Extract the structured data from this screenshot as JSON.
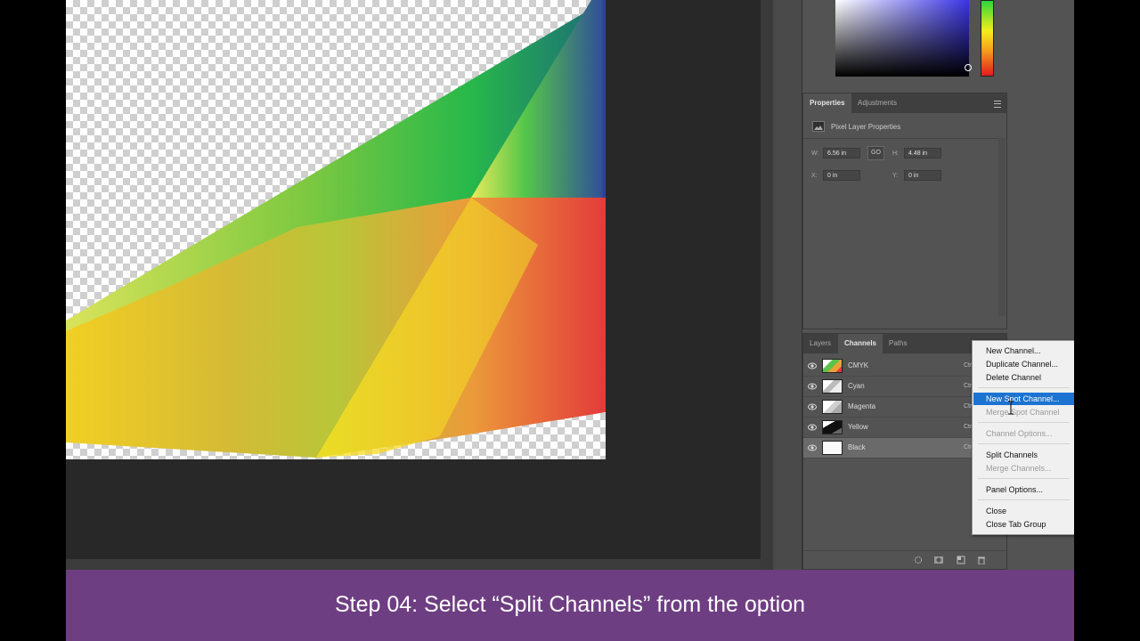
{
  "properties_panel": {
    "tabs": [
      "Properties",
      "Adjustments"
    ],
    "section_title": "Pixel Layer Properties",
    "w_label": "W:",
    "w_value": "6.56 in",
    "link_label": "GO",
    "h_label": "H:",
    "h_value": "4.48 in",
    "x_label": "X:",
    "x_value": "0 in",
    "y_label": "Y:",
    "y_value": "0 in"
  },
  "layers_panel": {
    "tabs": [
      "Layers",
      "Channels",
      "Paths"
    ],
    "active_tab": "Channels",
    "channels": [
      {
        "name": "CMYK",
        "shortcut": "Ctr",
        "selected": false
      },
      {
        "name": "Cyan",
        "shortcut": "Ctr",
        "selected": false
      },
      {
        "name": "Magenta",
        "shortcut": "Ctr",
        "selected": false
      },
      {
        "name": "Yellow",
        "shortcut": "Ctr",
        "selected": false
      },
      {
        "name": "Black",
        "shortcut": "Ctr",
        "selected": true
      }
    ]
  },
  "context_menu": {
    "items": [
      {
        "label": "New Channel...",
        "enabled": true
      },
      {
        "label": "Duplicate Channel...",
        "enabled": true
      },
      {
        "label": "Delete Channel",
        "enabled": true
      },
      {
        "label": "New Spot Channel...",
        "enabled": true,
        "highlighted": true
      },
      {
        "label": "Merge Spot Channel",
        "enabled": false
      },
      {
        "label": "Channel Options...",
        "enabled": false
      },
      {
        "label": "Split Channels",
        "enabled": true
      },
      {
        "label": "Merge Channels...",
        "enabled": false
      },
      {
        "label": "Panel Options...",
        "enabled": true
      },
      {
        "label": "Close",
        "enabled": true
      },
      {
        "label": "Close Tab Group",
        "enabled": true
      }
    ]
  },
  "caption": "Step 04: Select “Split Channels” from the option",
  "colors": {
    "caption_bar": "#6e3e82",
    "menu_highlight": "#1c73d1",
    "panel_bg": "#535353",
    "canvas_bg": "#282828"
  }
}
